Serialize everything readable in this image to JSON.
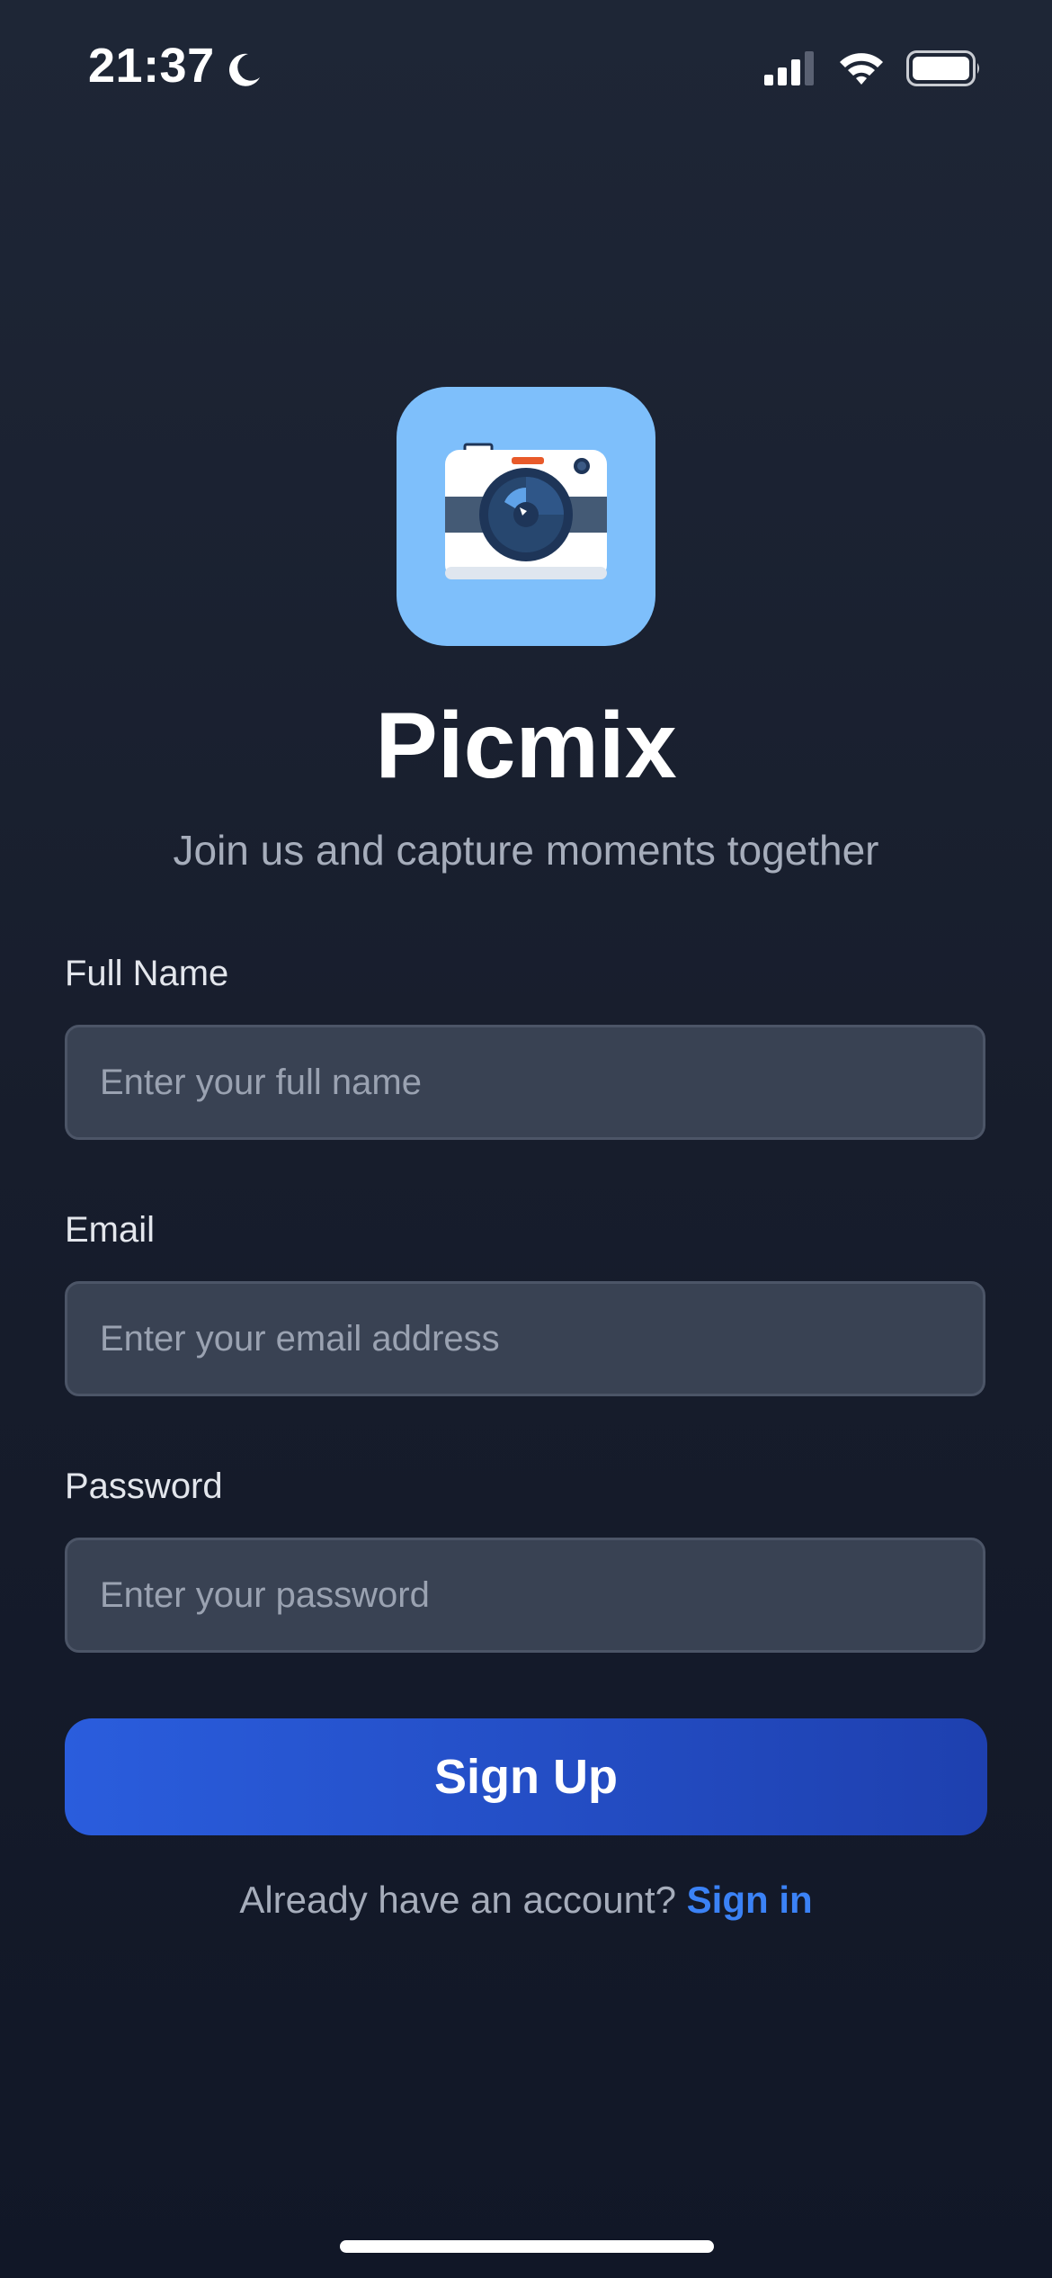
{
  "status_bar": {
    "time": "21:37",
    "icons": [
      "moon-icon",
      "signal-icon",
      "wifi-icon",
      "battery-icon"
    ]
  },
  "logo": {
    "icon": "camera-icon",
    "background_color": "#7ebffb"
  },
  "app_title": "Picmix",
  "app_subtitle": "Join us and capture moments together",
  "form": {
    "full_name": {
      "label": "Full Name",
      "placeholder": "Enter your full name",
      "value": ""
    },
    "email": {
      "label": "Email",
      "placeholder": "Enter your email address",
      "value": ""
    },
    "password": {
      "label": "Password",
      "placeholder": "Enter your password",
      "value": ""
    },
    "submit_label": "Sign Up"
  },
  "signin": {
    "prompt": "Already have an account?",
    "link_label": "Sign in"
  },
  "colors": {
    "accent": "#3b82f6",
    "button": "#2456d6",
    "background": "#171d2c"
  }
}
